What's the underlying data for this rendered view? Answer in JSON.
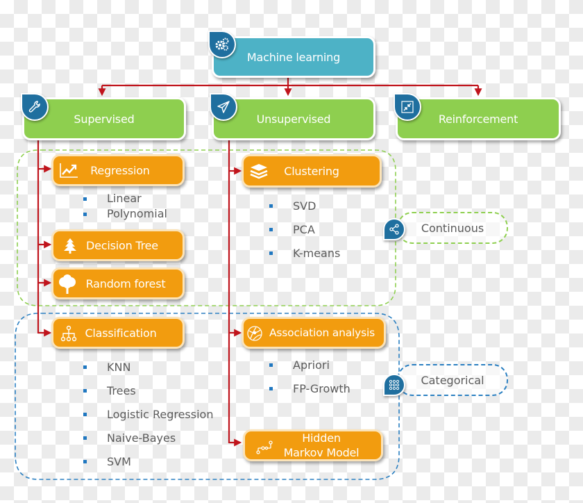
{
  "diagram": {
    "root": {
      "label": "Machine learning",
      "icon": "gears-icon"
    },
    "categories": [
      {
        "label": "Supervised",
        "icon": "wrench-icon"
      },
      {
        "label": "Unsupervised",
        "icon": "paper-plane-icon"
      },
      {
        "label": "Reinforcement",
        "icon": "compress-arrows-icon"
      }
    ],
    "supervised": {
      "regression": {
        "label": "Regression",
        "icon": "line-chart-icon",
        "items": [
          "Linear",
          "Polynomial"
        ]
      },
      "decision_tree": {
        "label": "Decision Tree",
        "icon": "pine-tree-icon"
      },
      "random_forest": {
        "label": "Random forest",
        "icon": "tree-icon"
      },
      "classification": {
        "label": "Classification",
        "icon": "hierarchy-icon",
        "items": [
          "KNN",
          "Trees",
          "Logistic Regression",
          "Naive-Bayes",
          "SVM"
        ]
      }
    },
    "unsupervised": {
      "clustering": {
        "label": "Clustering",
        "icon": "layers-icon",
        "items": [
          "SVD",
          "PCA",
          "K-means"
        ]
      },
      "association": {
        "label": "Association analysis",
        "icon": "network-globe-icon",
        "items": [
          "Apriori",
          "FP-Growth"
        ]
      },
      "hmm": {
        "label_line1": "Hidden",
        "label_line2": "Markov Model",
        "icon": "path-nodes-icon"
      }
    },
    "groups": {
      "continuous": {
        "label": "Continuous",
        "icon": "share-icon"
      },
      "categorical": {
        "label": "Categorical",
        "icon": "grid-dots-icon"
      }
    },
    "colors": {
      "root": "#4db2c6",
      "category": "#8ecf4f",
      "method": "#f29c0f",
      "connector": "#c0141c",
      "continuous_border": "#8ecf4f",
      "categorical_border": "#2a7fc1",
      "badge": "#1f6f9f",
      "bullet": "#1f77c0"
    }
  }
}
